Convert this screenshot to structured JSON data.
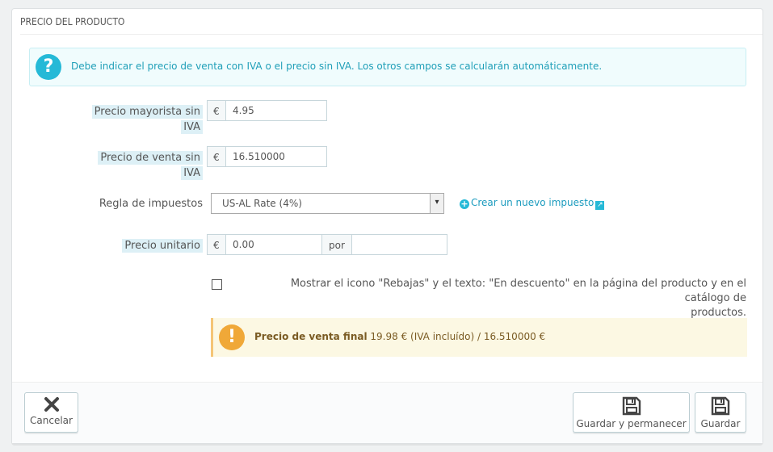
{
  "panel": {
    "title": "PRECIO DEL PRODUCTO"
  },
  "info_alert": {
    "icon": "question-icon",
    "text": "Debe indicar el precio de venta con IVA o el precio sin IVA. Los otros campos se calcularán automáticamente."
  },
  "wholesale": {
    "label_line1": "Precio mayorista sin",
    "label_line2": "IVA",
    "currency": "€",
    "value": "4.95"
  },
  "retail": {
    "label_line1": "Precio de venta sin",
    "label_line2": "IVA",
    "currency": "€",
    "value": "16.510000"
  },
  "tax_rule": {
    "label": "Regla de impuestos",
    "selected": "US-AL Rate (4%)",
    "create_link": "Crear un nuevo impuesto"
  },
  "unit_price": {
    "label": "Precio unitario",
    "currency": "€",
    "value": "0.00",
    "per_label": "por",
    "unit_value": ""
  },
  "on_sale": {
    "checked": false,
    "label_line1": "Mostrar el icono \"Rebajas\" y el texto: \"En descuento\" en la página del producto y en el catálogo de",
    "label_line2": "productos."
  },
  "final_price": {
    "icon": "warning-icon",
    "label": "Precio de venta final",
    "value": "19.98 € (IVA incluído) / 16.510000 €"
  },
  "footer": {
    "cancel_label": "Cancelar",
    "save_stay_label": "Guardar y permanecer",
    "save_label": "Guardar"
  },
  "colors": {
    "accent": "#25b9d7",
    "warning": "#f0a838",
    "info_bg": "#f0fcfd",
    "warning_bg": "#fcf8e3"
  }
}
